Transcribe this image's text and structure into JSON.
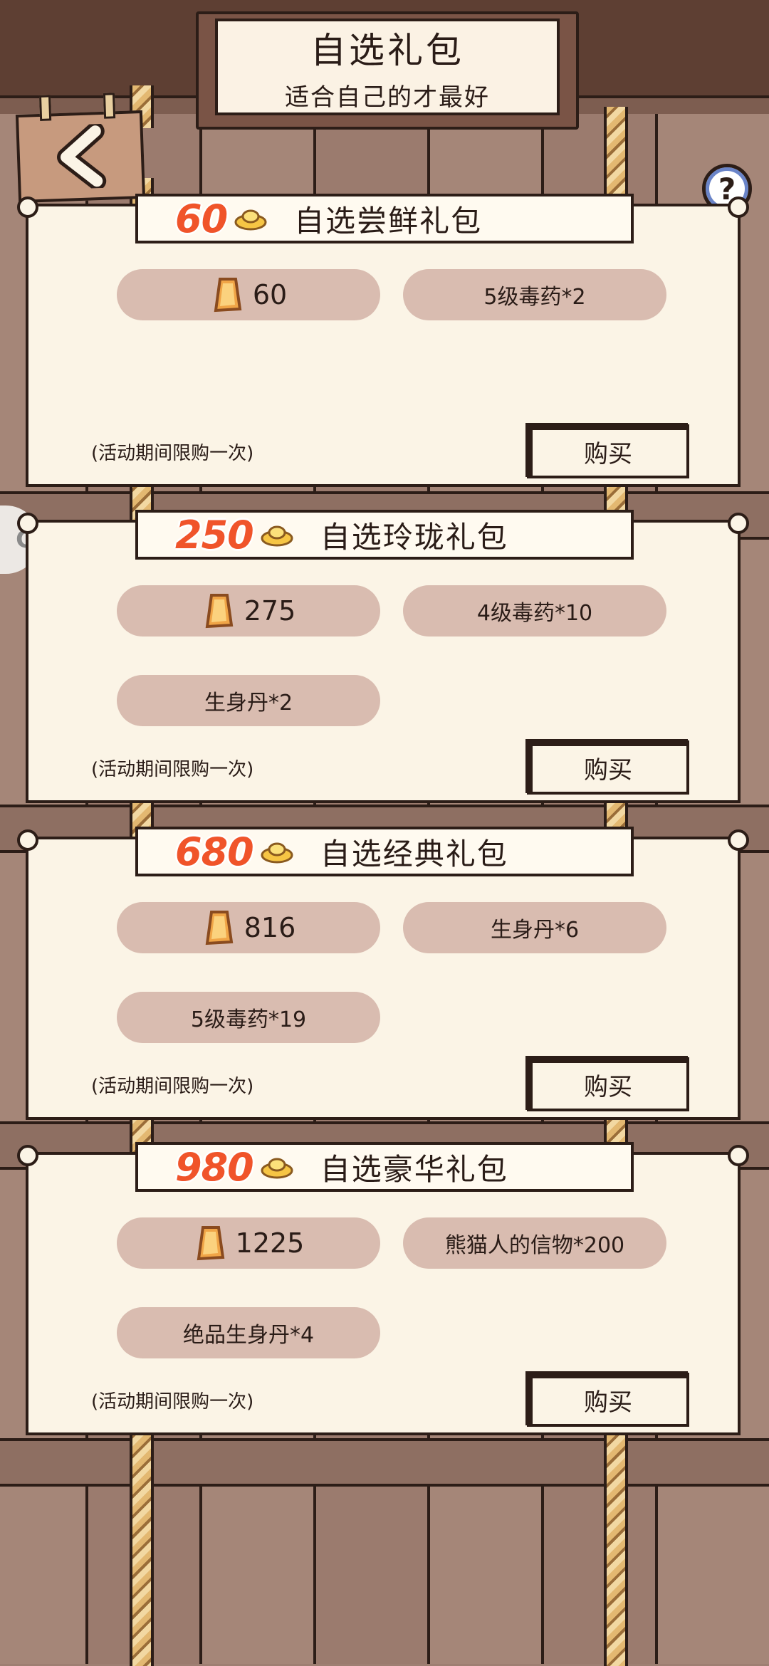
{
  "header": {
    "title": "自选礼包",
    "subtitle": "适合自己的才最好"
  },
  "icons": {
    "back": "chevron-left-icon",
    "help": "question-mark-icon",
    "currency": "gold-ingot-icon",
    "gold_bar": "gold-bar-icon"
  },
  "colors": {
    "price": "#f0542a",
    "pill": "#d9bcb0",
    "card": "#fbf4e6",
    "outline": "#2c1d17"
  },
  "help_label": "?",
  "side_tab_label": "G",
  "packs": [
    {
      "price": "60",
      "name": "自选尝鲜礼包",
      "gold": "60",
      "items": [
        "5级毒药*2"
      ],
      "limit": "(活动期间限购一次)",
      "buy": "购买"
    },
    {
      "price": "250",
      "name": "自选玲珑礼包",
      "gold": "275",
      "items": [
        "4级毒药*10",
        "生身丹*2"
      ],
      "limit": "(活动期间限购一次)",
      "buy": "购买"
    },
    {
      "price": "680",
      "name": "自选经典礼包",
      "gold": "816",
      "items": [
        "生身丹*6",
        "5级毒药*19"
      ],
      "limit": "(活动期间限购一次)",
      "buy": "购买"
    },
    {
      "price": "980",
      "name": "自选豪华礼包",
      "gold": "1225",
      "items": [
        "熊猫人的信物*200",
        "绝品生身丹*4"
      ],
      "limit": "(活动期间限购一次)",
      "buy": "购买"
    }
  ]
}
